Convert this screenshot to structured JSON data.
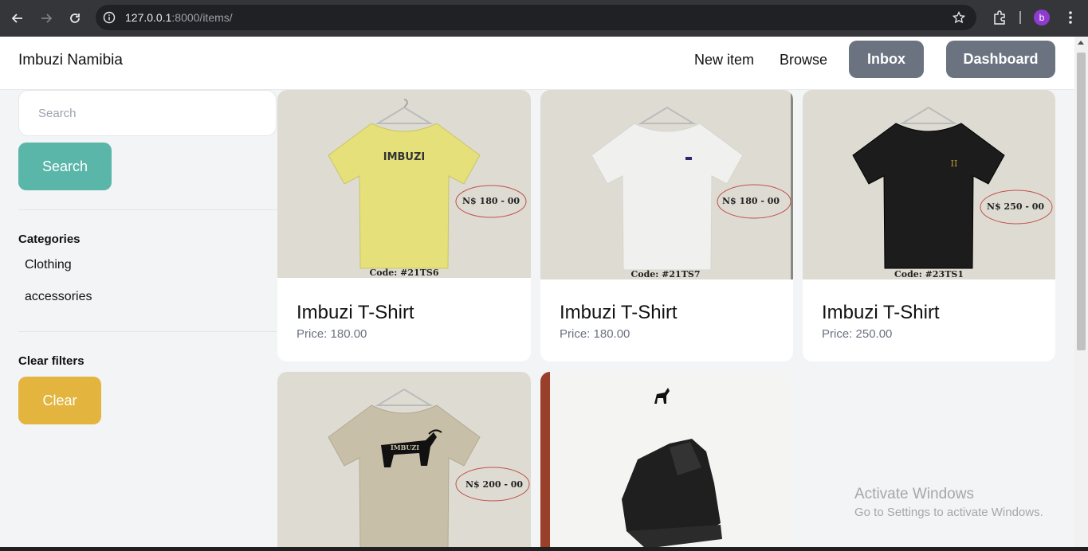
{
  "browser": {
    "url_host": "127.0.0.1",
    "url_rest": ":8000/items/",
    "profile_initial": "b"
  },
  "navbar": {
    "brand": "Imbuzi Namibia",
    "new_item": "New item",
    "browse": "Browse",
    "inbox": "Inbox",
    "dashboard": "Dashboard"
  },
  "sidebar": {
    "search_placeholder": "Search",
    "search_button": "Search",
    "categories_title": "Categories",
    "categories": [
      "Clothing",
      "accessories"
    ],
    "clear_filters_title": "Clear filters",
    "clear_button": "Clear"
  },
  "items": [
    {
      "title": "Imbuzi T-Shirt",
      "price": "Price: 180.00",
      "shirt_color": "#e5e07a",
      "print_text": "IMBUZI",
      "tag_text": "N$ 180 - 00",
      "code": "Code: #21TS6"
    },
    {
      "title": "Imbuzi T-Shirt",
      "price": "Price: 180.00",
      "shirt_color": "#f0f0ee",
      "tag_text": "N$ 180 - 00",
      "code": "Code: #21TS7"
    },
    {
      "title": "Imbuzi T-Shirt",
      "price": "Price: 250.00",
      "shirt_color": "#1c1c1c",
      "print_text": "II",
      "tag_text": "N$ 250 - 00",
      "code": "Code: #23TS1"
    },
    {
      "shirt_color": "#c8bfa9",
      "print_text": "IMBUZI",
      "tag_text": "N$ 200 - 00"
    },
    {}
  ],
  "watermark": {
    "line1": "Activate Windows",
    "line2": "Go to Settings to activate Windows."
  }
}
